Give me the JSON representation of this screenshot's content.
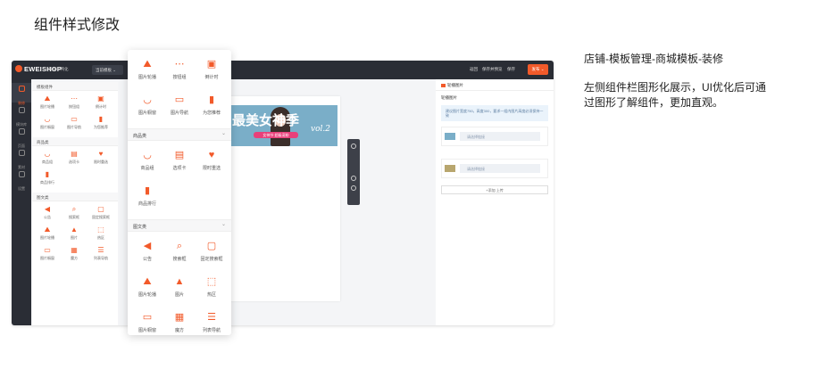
{
  "page_title": "组件样式修改",
  "editor": {
    "logo": "EWEISHOP",
    "shop_name": "黄律千鸭化",
    "template_select": "当前模板  ⌄",
    "top_links": [
      "返回",
      "保存并预览",
      "保存"
    ],
    "publish": "发布 ⌄",
    "nav": [
      {
        "label": "装修",
        "active": true
      },
      {
        "label": "模块库",
        "active": false
      },
      {
        "label": "页面",
        "active": false
      },
      {
        "label": "素材",
        "active": false
      },
      {
        "label": "设置",
        "active": false
      }
    ],
    "small_palette": [
      {
        "section": "模板组件",
        "items": [
          {
            "label": "图片轮播",
            "icon": "⛰"
          },
          {
            "label": "按钮组",
            "icon": "⋯"
          },
          {
            "label": "倒计时",
            "icon": "▣"
          },
          {
            "label": "图片橱窗",
            "icon": "◡"
          },
          {
            "label": "图片导航",
            "icon": "▭"
          },
          {
            "label": "为您推荐",
            "icon": "▮"
          }
        ]
      },
      {
        "section": "商品类",
        "items": [
          {
            "label": "商品组",
            "icon": "◡"
          },
          {
            "label": "选项卡",
            "icon": "▤"
          },
          {
            "label": "限时重选",
            "icon": "♥"
          },
          {
            "label": "商品排行",
            "icon": "▮"
          }
        ]
      },
      {
        "section": "图文类",
        "items": [
          {
            "label": "公告",
            "icon": "◀"
          },
          {
            "label": "搜索框",
            "icon": "⌕"
          },
          {
            "label": "固定搜索框",
            "icon": "▢"
          },
          {
            "label": "图片轮播",
            "icon": "⛰"
          },
          {
            "label": "图片",
            "icon": "▲"
          },
          {
            "label": "热区",
            "icon": "⬚"
          },
          {
            "label": "图片橱窗",
            "icon": "▭"
          },
          {
            "label": "魔方",
            "icon": "▦"
          },
          {
            "label": "列表导航",
            "icon": "☰"
          }
        ]
      }
    ],
    "banner": {
      "text": "最美女神季",
      "badge": "女神节·超级宠粉",
      "vol": "vol.2"
    },
    "right_panel": {
      "header": "轮播图片",
      "sub": "轮播图片",
      "tip": "建议图片宽度750，高度300，要求一组内图片高度必须保持一致",
      "items": [
        {
          "link": "请选择链接"
        },
        {
          "link": "请选择链接"
        }
      ],
      "add": "+添加 上传"
    }
  },
  "big_palette": {
    "groups": [
      {
        "section": "",
        "items": [
          {
            "label": "图片轮播",
            "icon": "⛰"
          },
          {
            "label": "按钮组",
            "icon": "⋯"
          },
          {
            "label": "倒计时",
            "icon": "▣"
          },
          {
            "label": "图片橱窗",
            "icon": "◡"
          },
          {
            "label": "图片导航",
            "icon": "▭"
          },
          {
            "label": "为您推荐",
            "icon": "▮"
          }
        ]
      },
      {
        "section": "商品类",
        "items": [
          {
            "label": "商品组",
            "icon": "◡"
          },
          {
            "label": "选项卡",
            "icon": "▤"
          },
          {
            "label": "限时重选",
            "icon": "♥"
          },
          {
            "label": "商品排行",
            "icon": "▮"
          }
        ]
      },
      {
        "section": "图文类",
        "items": [
          {
            "label": "公告",
            "icon": "◀"
          },
          {
            "label": "搜索框",
            "icon": "⌕"
          },
          {
            "label": "固定搜索框",
            "icon": "▢"
          },
          {
            "label": "图片轮播",
            "icon": "⛰"
          },
          {
            "label": "图片",
            "icon": "▲"
          },
          {
            "label": "热区",
            "icon": "⬚"
          },
          {
            "label": "图片橱窗",
            "icon": "▭"
          },
          {
            "label": "魔方",
            "icon": "▦"
          },
          {
            "label": "列表导航",
            "icon": "☰"
          }
        ]
      }
    ]
  },
  "description": {
    "path": "店铺-模板管理-商城模板-装修",
    "line1": "左侧组件栏图形化展示，UI优化后可通",
    "line2": "过图形了解组件，更加直观。"
  }
}
